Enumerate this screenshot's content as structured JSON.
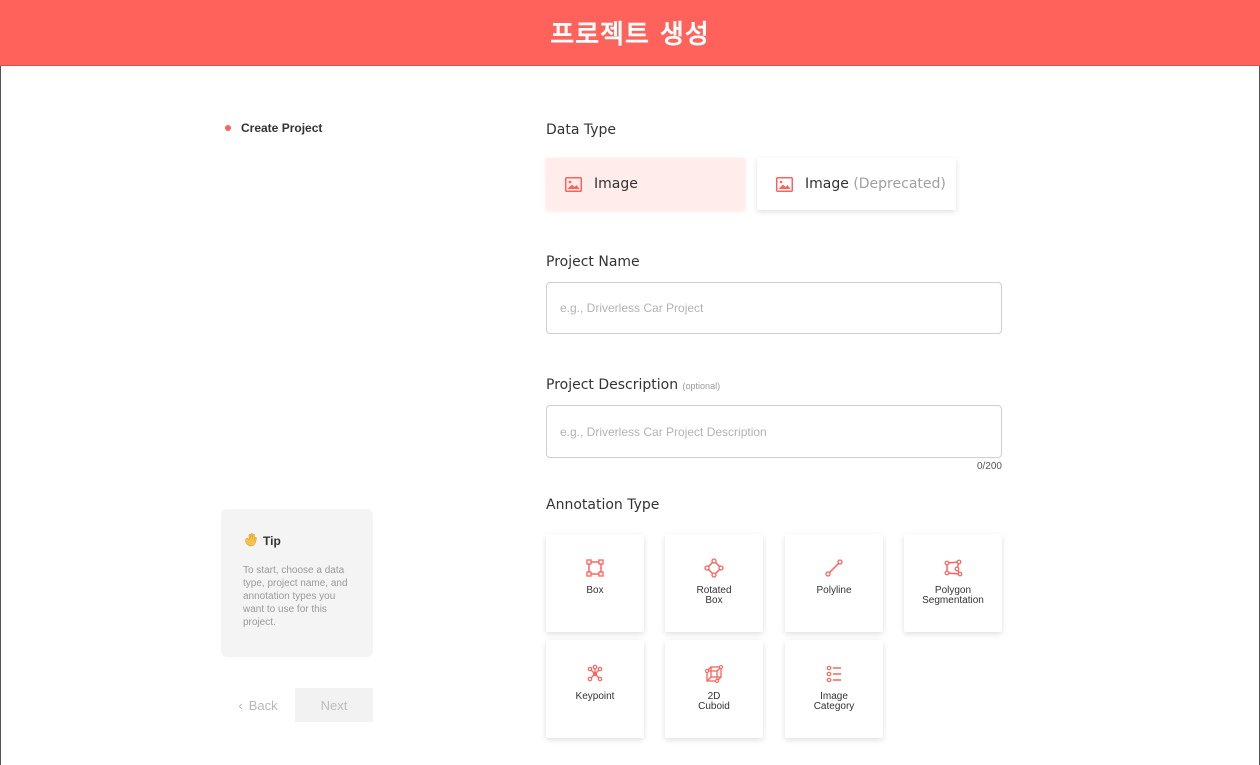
{
  "header": {
    "title": "프로젝트 생성"
  },
  "steps": [
    {
      "label": "Create Project",
      "active": true
    }
  ],
  "tip": {
    "title": "Tip",
    "icon": "waving-hand-icon",
    "text": "To start, choose a data type, project name, and annotation types you want to use for this project."
  },
  "nav": {
    "back_label": "Back",
    "back_icon": "‹",
    "next_label": "Next"
  },
  "data_type": {
    "label": "Data Type",
    "options": [
      {
        "label": "Image",
        "suffix": "",
        "selected": true
      },
      {
        "label": "Image",
        "suffix": "(Deprecated)",
        "selected": false
      }
    ]
  },
  "project_name": {
    "label": "Project Name",
    "placeholder": "e.g., Driverless Car Project",
    "value": ""
  },
  "project_description": {
    "label": "Project Description",
    "optional_label": "(optional)",
    "placeholder": "e.g., Driverless Car Project Description",
    "value": "",
    "counter": "0/200"
  },
  "annotation_type": {
    "label": "Annotation Type",
    "options": [
      {
        "label": "Box",
        "icon": "box-icon"
      },
      {
        "label": "Rotated\nBox",
        "icon": "rotated-box-icon"
      },
      {
        "label": "Polyline",
        "icon": "polyline-icon"
      },
      {
        "label": "Polygon\nSegmentation",
        "icon": "polygon-icon"
      },
      {
        "label": "Keypoint",
        "icon": "keypoint-icon"
      },
      {
        "label": "2D\nCuboid",
        "icon": "cuboid-icon"
      },
      {
        "label": "Image\nCategory",
        "icon": "image-category-icon"
      }
    ]
  },
  "colors": {
    "accent": "#ff625a",
    "selected_bg": "#ffeceb",
    "tip_bg": "#f4f4f4"
  }
}
